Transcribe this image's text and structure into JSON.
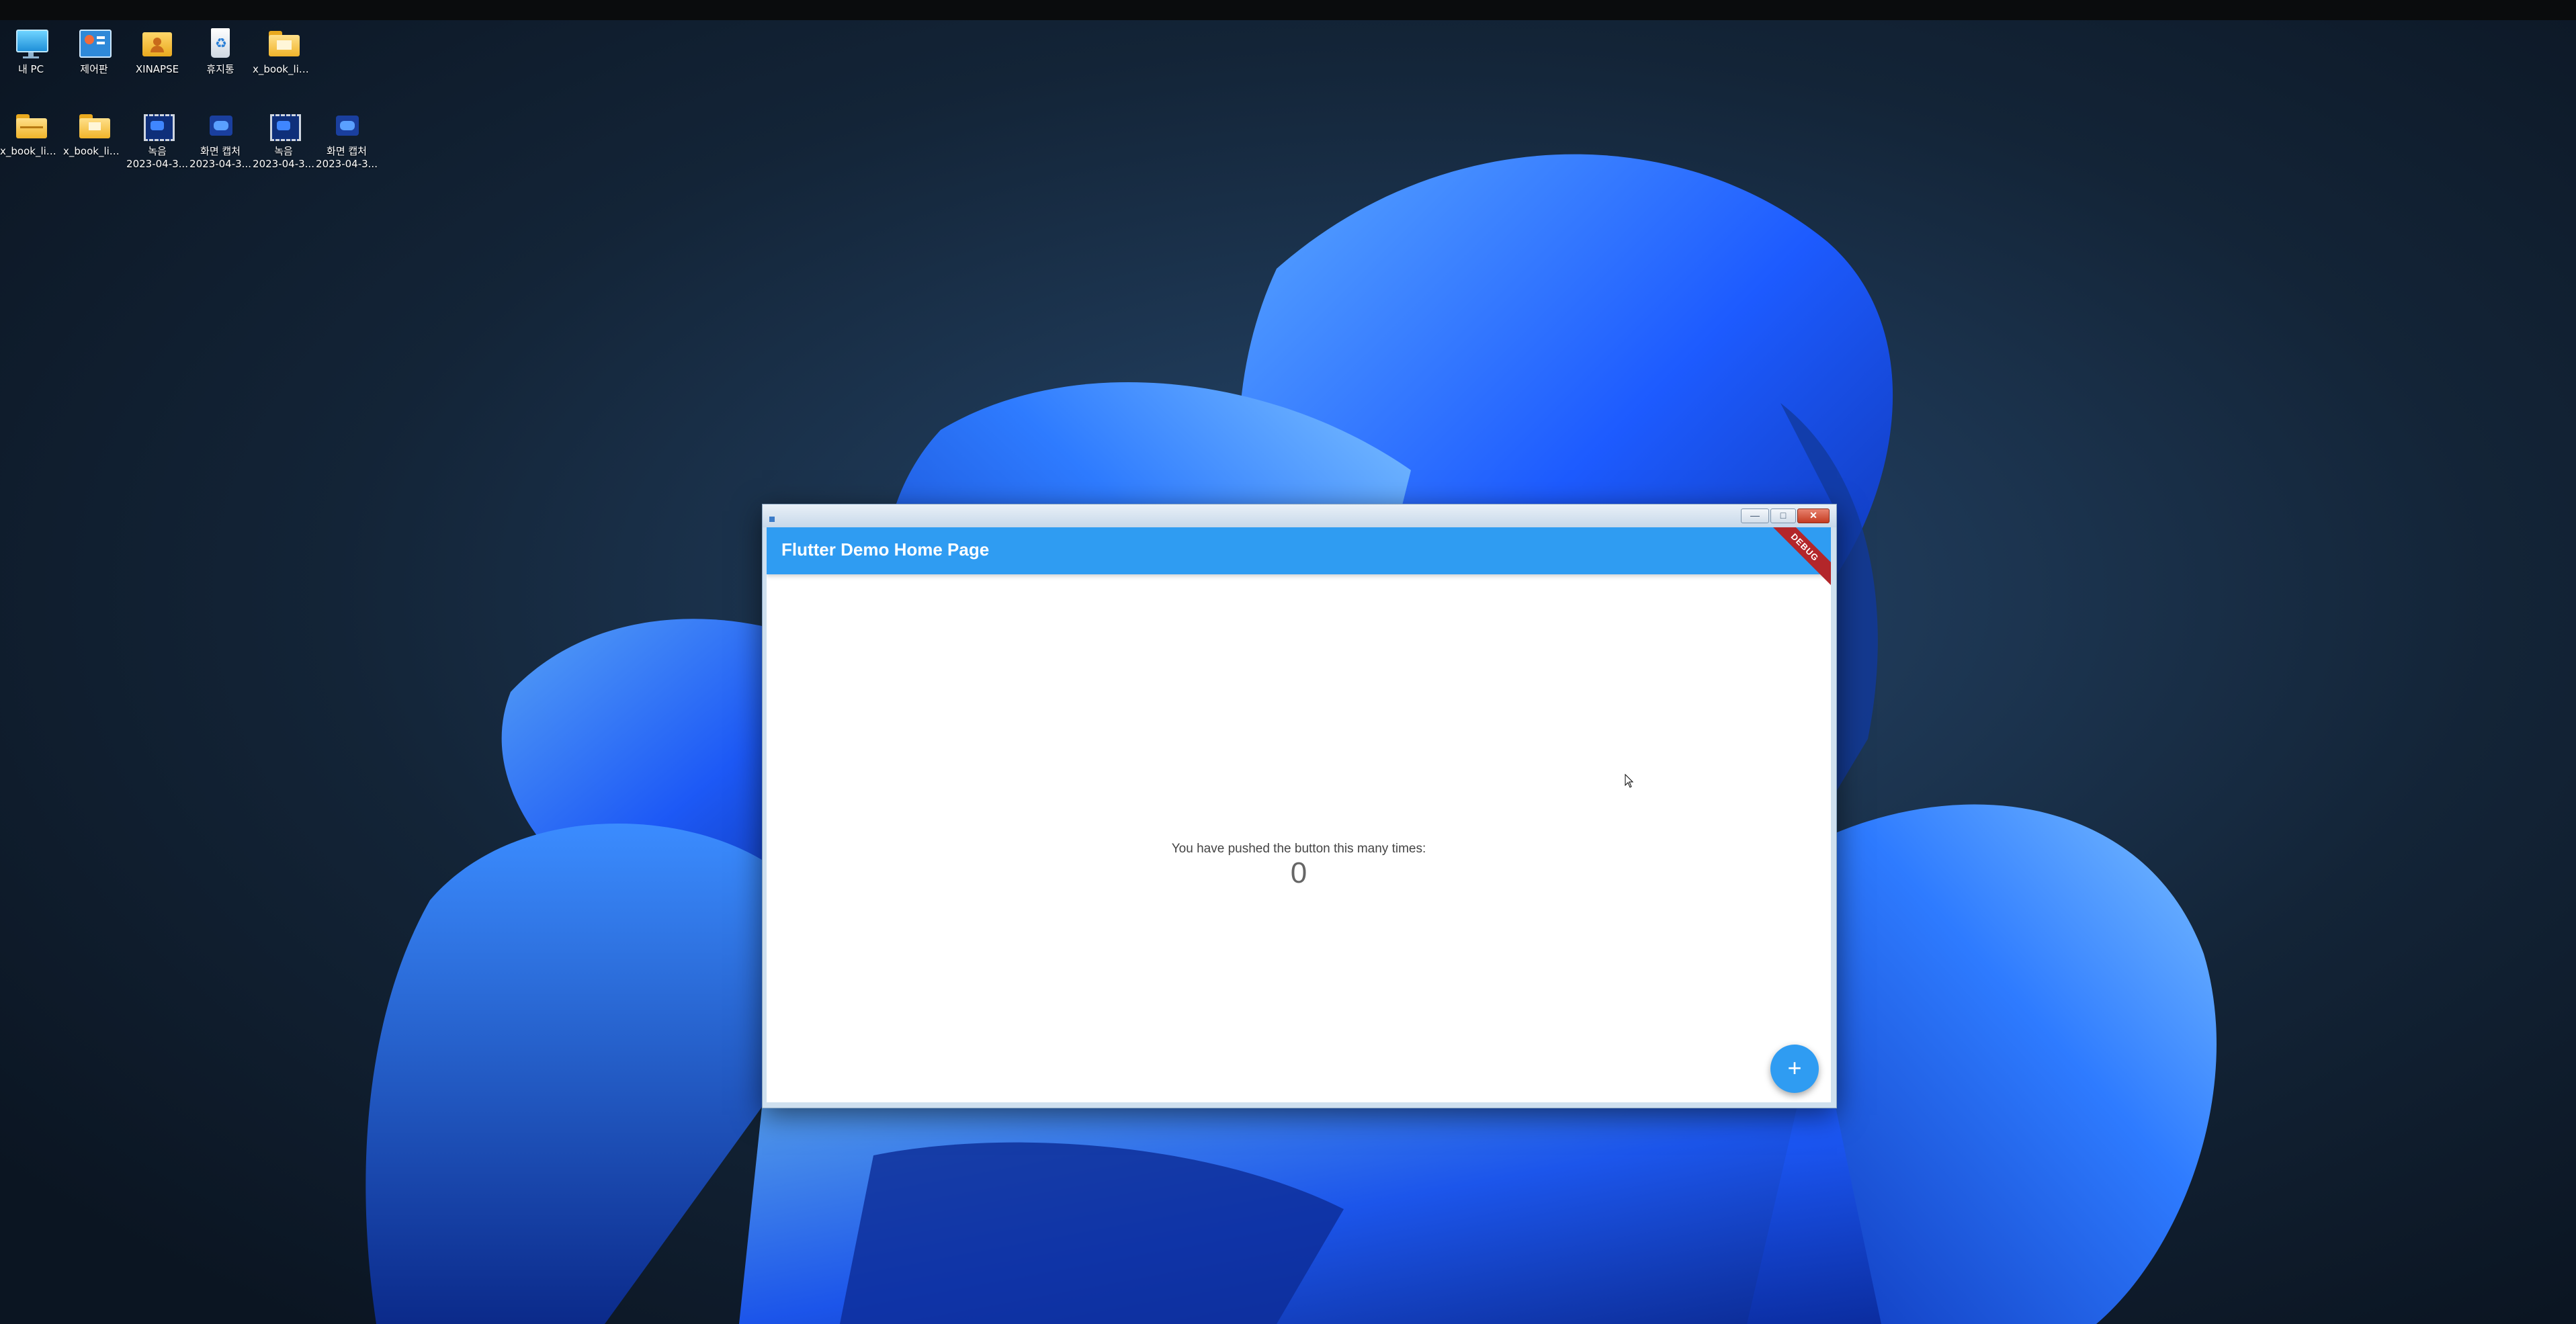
{
  "desktop": {
    "icons": [
      {
        "name": "pc-icon",
        "label": "내 PC",
        "kind": "monitor"
      },
      {
        "name": "control-panel-icon",
        "label": "제어판",
        "kind": "control"
      },
      {
        "name": "xinapse-folder-icon",
        "label": "XINAPSE",
        "kind": "folder-user"
      },
      {
        "name": "recycle-bin-icon",
        "label": "휴지통",
        "kind": "recycle"
      },
      {
        "name": "folder-icon",
        "label": "x_book_libr...",
        "kind": "folder"
      },
      {
        "name": "folder-icon",
        "label": "x_book_libr...",
        "kind": "folder-open"
      },
      {
        "name": "folder-icon",
        "label": "x_book_libr...",
        "kind": "folder"
      },
      {
        "name": "video-file-icon",
        "label": "녹음",
        "sublabel": "2023-04-3...",
        "kind": "video"
      },
      {
        "name": "screenshot-file-icon",
        "label": "화면 캡처",
        "sublabel": "2023-04-3...",
        "kind": "capture"
      },
      {
        "name": "video-file-icon",
        "label": "녹음",
        "sublabel": "2023-04-3...",
        "kind": "video"
      },
      {
        "name": "screenshot-file-icon",
        "label": "화면 캡처",
        "sublabel": "2023-04-3...",
        "kind": "capture"
      }
    ]
  },
  "window": {
    "app_title": "Flutter Demo Home Page",
    "debug_banner": "DEBUG",
    "minimize": "—",
    "maximize": "□",
    "close": "✕",
    "counter_label": "You have pushed the button this many times:",
    "counter_value": "0",
    "fab_label": "+"
  },
  "colors": {
    "accent": "#2f9cf2",
    "debug": "#b3262a",
    "wallpaper_bg": "#0f1c2e",
    "bloom": "#1e63ff"
  }
}
